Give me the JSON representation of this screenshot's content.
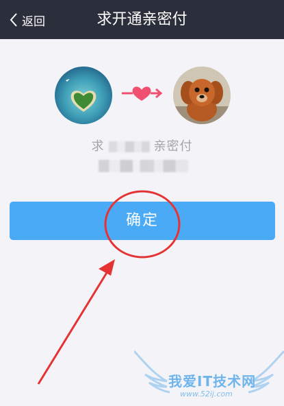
{
  "navbar": {
    "back_label": "返回",
    "title": "求开通亲密付"
  },
  "content": {
    "request_prefix": "求",
    "request_suffix": "亲密付"
  },
  "confirm_label": "确定",
  "watermark": {
    "text": "我爱IT技术网",
    "url": "www.52ij.com"
  },
  "colors": {
    "navbar": "#2b2f3b",
    "button": "#4baaf5",
    "annotation": "#e53333",
    "heart": "#f04f6f"
  },
  "icons": [
    "chevron-left-icon",
    "heart-arrow-icon"
  ]
}
